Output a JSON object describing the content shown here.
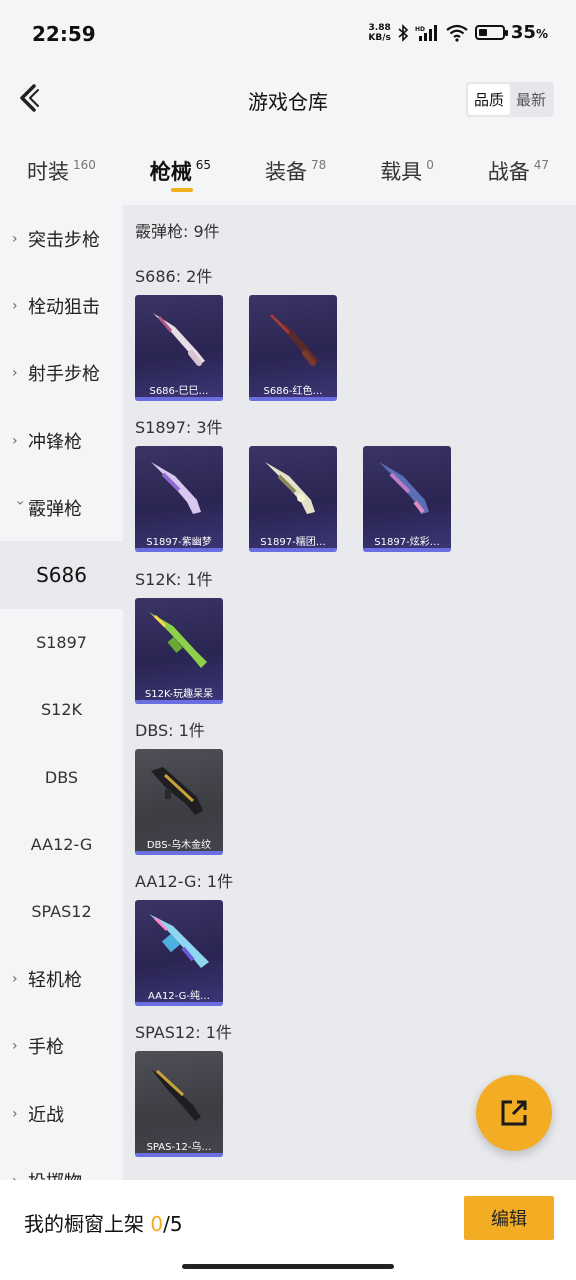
{
  "status": {
    "time": "22:59",
    "net_speed_value": "3.88",
    "net_speed_unit": "KB/s",
    "battery_percent": "35",
    "battery_unit": "%",
    "battery_level": 0.35
  },
  "header": {
    "title": "游戏仓库",
    "sort_quality": "品质",
    "sort_newest": "最新"
  },
  "tabs": [
    {
      "label": "时装",
      "count": "160"
    },
    {
      "label": "枪械",
      "count": "65"
    },
    {
      "label": "装备",
      "count": "78"
    },
    {
      "label": "载具",
      "count": "0"
    },
    {
      "label": "战备",
      "count": "47"
    }
  ],
  "sidebar": {
    "categories_top": [
      "突击步枪",
      "栓动狙击",
      "射手步枪",
      "冲锋枪"
    ],
    "expanded": "霰弹枪",
    "sub_items": [
      "S686",
      "S1897",
      "S12K",
      "DBS",
      "AA12-G",
      "SPAS12"
    ],
    "categories_bottom": [
      "轻机枪",
      "手枪",
      "近战",
      "投掷物"
    ]
  },
  "content": {
    "section_title": "霰弹枪: 9件",
    "groups": [
      {
        "title": "S686: 2件",
        "items": [
          "S686-巳巳…",
          "S686-红色…"
        ]
      },
      {
        "title": "S1897: 3件",
        "items": [
          "S1897-紫幽梦",
          "S1897-糯团…",
          "S1897-炫彩…"
        ]
      },
      {
        "title": "S12K: 1件",
        "items": [
          "S12K-玩趣呆呆"
        ]
      },
      {
        "title": "DBS: 1件",
        "items": [
          "DBS-乌木金纹"
        ]
      },
      {
        "title": "AA12-G: 1件",
        "items": [
          "AA12-G-纯…"
        ]
      },
      {
        "title": "SPAS12: 1件",
        "items": [
          "SPAS-12-乌…"
        ]
      }
    ]
  },
  "bottom": {
    "shelf_label": "我的橱窗上架 ",
    "shelf_current": "0",
    "shelf_total": "/5",
    "edit_label": "编辑"
  }
}
